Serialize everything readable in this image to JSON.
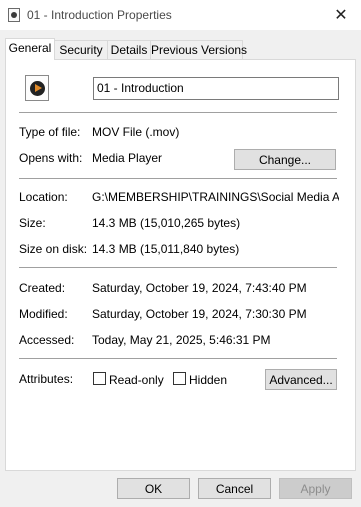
{
  "window": {
    "title": "01 - Introduction Properties",
    "close_symbol": "✕"
  },
  "tabs": [
    {
      "label": "General",
      "active": true
    },
    {
      "label": "Security",
      "active": false
    },
    {
      "label": "Details",
      "active": false
    },
    {
      "label": "Previous Versions",
      "active": false
    }
  ],
  "general": {
    "file_icon": "video-file-icon",
    "file_name": "01 - Introduction",
    "type_of_file_label": "Type of file:",
    "type_of_file_value": "MOV File (.mov)",
    "opens_with_label": "Opens with:",
    "opens_with_value": "Media Player",
    "change_button": "Change...",
    "location_label": "Location:",
    "location_value": "G:\\MEMBERSHIP\\TRAININGS\\Social Media Autor",
    "size_label": "Size:",
    "size_value": "14.3 MB (15,010,265 bytes)",
    "size_on_disk_label": "Size on disk:",
    "size_on_disk_value": "14.3 MB (15,011,840 bytes)",
    "created_label": "Created:",
    "created_value": "Saturday, October 19, 2024, 7:43:40 PM",
    "modified_label": "Modified:",
    "modified_value": "Saturday, October 19, 2024, 7:30:30 PM",
    "accessed_label": "Accessed:",
    "accessed_value": "Today, May 21, 2025, 5:46:31 PM",
    "attributes_label": "Attributes:",
    "readonly_label": "Read-only",
    "readonly_checked": false,
    "hidden_label": "Hidden",
    "hidden_checked": false,
    "advanced_button": "Advanced..."
  },
  "footer": {
    "ok_button": "OK",
    "cancel_button": "Cancel",
    "apply_button": "Apply"
  }
}
